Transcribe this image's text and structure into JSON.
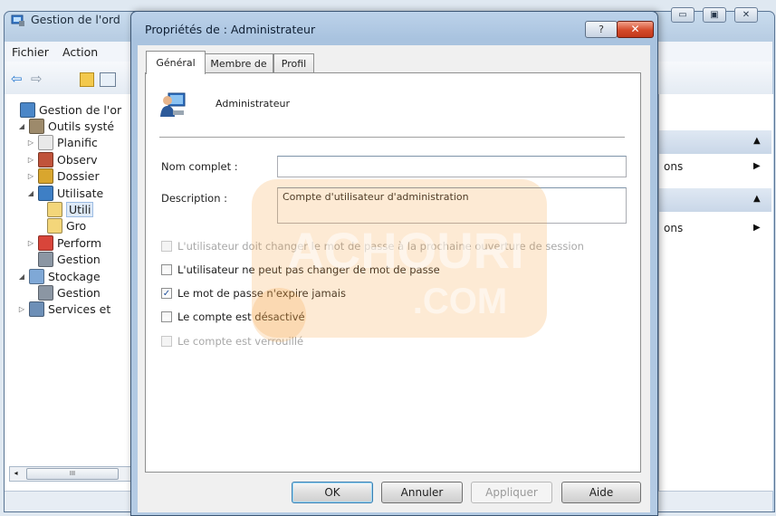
{
  "background_window": {
    "title": "Gestion de l'ord",
    "menu": [
      "Fichier",
      "Action"
    ],
    "tree": [
      {
        "label": "Gestion de l'or",
        "indent": 0,
        "arrow": "",
        "icon": "computer-management-icon"
      },
      {
        "label": "Outils systé",
        "indent": 1,
        "arrow": "◢",
        "icon": "tools-icon"
      },
      {
        "label": "Planific",
        "indent": 2,
        "arrow": "▷",
        "icon": "clock-icon"
      },
      {
        "label": "Observ",
        "indent": 2,
        "arrow": "▷",
        "icon": "event-viewer-icon"
      },
      {
        "label": "Dossier",
        "indent": 2,
        "arrow": "▷",
        "icon": "shared-folder-icon"
      },
      {
        "label": "Utilisate",
        "indent": 2,
        "arrow": "◢",
        "icon": "users-icon"
      },
      {
        "label": "Utili",
        "indent": 3,
        "arrow": "",
        "icon": "folder-icon",
        "selected": true
      },
      {
        "label": "Gro",
        "indent": 3,
        "arrow": "",
        "icon": "folder-icon"
      },
      {
        "label": "Perform",
        "indent": 2,
        "arrow": "▷",
        "icon": "performance-icon"
      },
      {
        "label": "Gestion",
        "indent": 2,
        "arrow": "",
        "icon": "device-manager-icon"
      },
      {
        "label": "Stockage",
        "indent": 1,
        "arrow": "◢",
        "icon": "storage-icon"
      },
      {
        "label": "Gestion",
        "indent": 2,
        "arrow": "",
        "icon": "disk-icon"
      },
      {
        "label": "Services et",
        "indent": 1,
        "arrow": "▷",
        "icon": "services-icon"
      }
    ],
    "scroll_thumb_label": "III",
    "actions": [
      {
        "label": "ons"
      },
      {
        "label": "ons"
      }
    ]
  },
  "dialog": {
    "title": "Propriétés de : Administrateur",
    "help_label": "?",
    "close_label": "✕",
    "tabs": [
      "Général",
      "Membre de",
      "Profil"
    ],
    "user_name": "Administrateur",
    "full_name_label": "Nom complet :",
    "full_name_value": "",
    "description_label": "Description :",
    "description_value": "Compte d'utilisateur d'administration",
    "checkboxes": [
      {
        "label": "L'utilisateur doit changer le mot de passe à la prochaine ouverture de session",
        "checked": false,
        "enabled": false
      },
      {
        "label": "L'utilisateur ne peut pas changer de mot de passe",
        "checked": false,
        "enabled": true
      },
      {
        "label": "Le mot de passe n'expire jamais",
        "checked": true,
        "enabled": true
      },
      {
        "label": "Le compte est désactivé",
        "checked": false,
        "enabled": true
      },
      {
        "label": "Le compte est verrouillé",
        "checked": false,
        "enabled": false
      }
    ],
    "buttons": {
      "ok": "OK",
      "cancel": "Annuler",
      "apply": "Appliquer",
      "help": "Aide"
    }
  },
  "watermark": {
    "line1": "ACHOURI",
    "line2": ".COM"
  },
  "colors": {
    "accent": "#3c7fb1",
    "close": "#d44a2a",
    "watermark": "#f0a040"
  }
}
